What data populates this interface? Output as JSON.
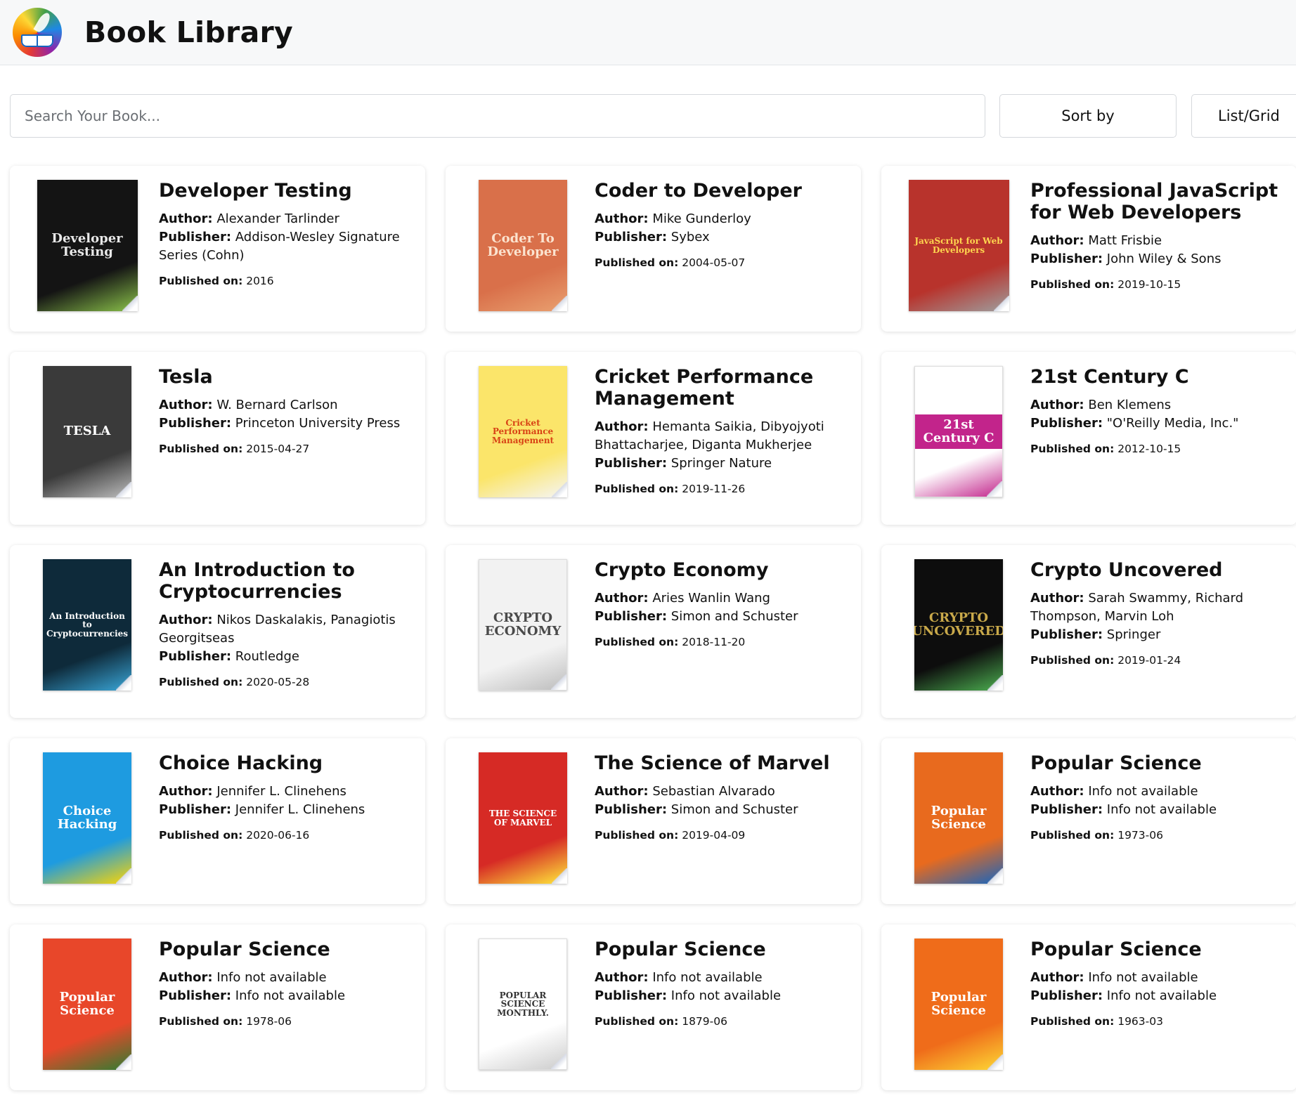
{
  "header": {
    "app_title": "Book Library"
  },
  "toolbar": {
    "search_placeholder": "Search Your Book...",
    "sort_label": "Sort by",
    "view_label": "List/Grid"
  },
  "labels": {
    "author": "Author:",
    "publisher": "Publisher:",
    "published": "Published on:"
  },
  "books": [
    {
      "title": "Developer Testing",
      "author": "Alexander Tarlinder",
      "publisher": "Addison-Wesley Signature Series (Cohn)",
      "published": "2016",
      "cover": {
        "text": "Developer Testing",
        "bg": "#141414",
        "fg": "#e8e8e8",
        "accent": "#8bc34a"
      }
    },
    {
      "title": "Coder to Developer",
      "author": "Mike Gunderloy",
      "publisher": "Sybex",
      "published": "2004-05-07",
      "cover": {
        "text": "Coder To Developer",
        "bg": "#d9704a",
        "fg": "#fbe3cf",
        "accent": "#e9a070"
      }
    },
    {
      "title": "Professional JavaScript for Web Developers",
      "author": "Matt Frisbie",
      "publisher": "John Wiley & Sons",
      "published": "2019-10-15",
      "cover": {
        "text": "JavaScript for Web Developers",
        "bg": "#b8332c",
        "fg": "#ffd54f",
        "accent": "#9e9e9e"
      }
    },
    {
      "title": "Tesla",
      "author": "W. Bernard Carlson",
      "publisher": "Princeton University Press",
      "published": "2015-04-27",
      "cover": {
        "text": "TESLA",
        "bg": "#3a3a3a",
        "fg": "#ffffff",
        "accent": "#bdbdbd"
      }
    },
    {
      "title": "Cricket Performance Management",
      "author": "Hemanta Saikia, Dibyojyoti Bhattacharjee, Diganta Mukherjee",
      "publisher": "Springer Nature",
      "published": "2019-11-26",
      "cover": {
        "text": "Cricket Performance Management",
        "bg": "#fbe56a",
        "fg": "#d84315",
        "accent": "#f5f5f5"
      }
    },
    {
      "title": "21st Century C",
      "author": "Ben Klemens",
      "publisher": "\"O'Reilly Media, Inc.\"",
      "published": "2012-10-15",
      "cover": {
        "text": "21st Century C",
        "bg": "#ffffff",
        "fg": "#ffffff",
        "accent": "#c2248b"
      }
    },
    {
      "title": "An Introduction to Cryptocurrencies",
      "author": "Nikos Daskalakis, Panagiotis Georgitseas",
      "publisher": "Routledge",
      "published": "2020-05-28",
      "cover": {
        "text": "An Introduction to Cryptocurrencies",
        "bg": "#0e2a3a",
        "fg": "#ffffff",
        "accent": "#3aa7d9"
      }
    },
    {
      "title": "Crypto Economy",
      "author": "Aries Wanlin Wang",
      "publisher": "Simon and Schuster",
      "published": "2018-11-20",
      "cover": {
        "text": "CRYPTO ECONOMY",
        "bg": "#f2f2f2",
        "fg": "#4a4a4a",
        "accent": "#bdbdbd"
      }
    },
    {
      "title": "Crypto Uncovered",
      "author": "Sarah Swammy, Richard Thompson, Marvin Loh",
      "publisher": "Springer",
      "published": "2019-01-24",
      "cover": {
        "text": "CRYPTO UNCOVERED",
        "bg": "#0d0d0d",
        "fg": "#c9a94a",
        "accent": "#4caf50"
      }
    },
    {
      "title": "Choice Hacking",
      "author": "Jennifer L. Clinehens",
      "publisher": "Jennifer L. Clinehens",
      "published": "2020-06-16",
      "cover": {
        "text": "Choice Hacking",
        "bg": "#1e9be0",
        "fg": "#ffffff",
        "accent": "#ffd600"
      }
    },
    {
      "title": "The Science of Marvel",
      "author": "Sebastian Alvarado",
      "publisher": "Simon and Schuster",
      "published": "2019-04-09",
      "cover": {
        "text": "THE SCIENCE OF MARVEL",
        "bg": "#d62a25",
        "fg": "#ffffff",
        "accent": "#ffeb3b"
      }
    },
    {
      "title": "Popular Science",
      "author": "Info not available",
      "publisher": "Info not available",
      "published": "1973-06",
      "cover": {
        "text": "Popular Science",
        "bg": "#e86a1e",
        "fg": "#ffffff",
        "accent": "#1565c0"
      }
    },
    {
      "title": "Popular Science",
      "author": "Info not available",
      "publisher": "Info not available",
      "published": "1978-06",
      "cover": {
        "text": "Popular Science",
        "bg": "#e8472a",
        "fg": "#ffffff",
        "accent": "#2e7d32"
      }
    },
    {
      "title": "Popular Science",
      "author": "Info not available",
      "publisher": "Info not available",
      "published": "1879-06",
      "cover": {
        "text": "POPULAR SCIENCE MONTHLY.",
        "bg": "#ffffff",
        "fg": "#333333",
        "accent": "#cccccc"
      }
    },
    {
      "title": "Popular Science",
      "author": "Info not available",
      "publisher": "Info not available",
      "published": "1963-03",
      "cover": {
        "text": "Popular Science",
        "bg": "#ef6c1a",
        "fg": "#ffffff",
        "accent": "#fdd835"
      }
    }
  ]
}
